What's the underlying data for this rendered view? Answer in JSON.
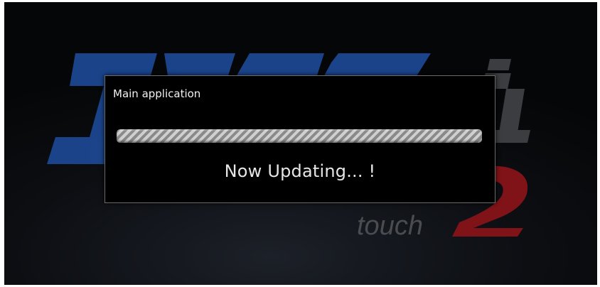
{
  "background": {
    "logo_text": "touch",
    "logo_accent_color": "#1e4a9c",
    "logo_red_color": "#a0141a"
  },
  "dialog": {
    "title": "Main application",
    "progress": {
      "state": "indeterminate"
    },
    "message": "Now Updating... !"
  }
}
